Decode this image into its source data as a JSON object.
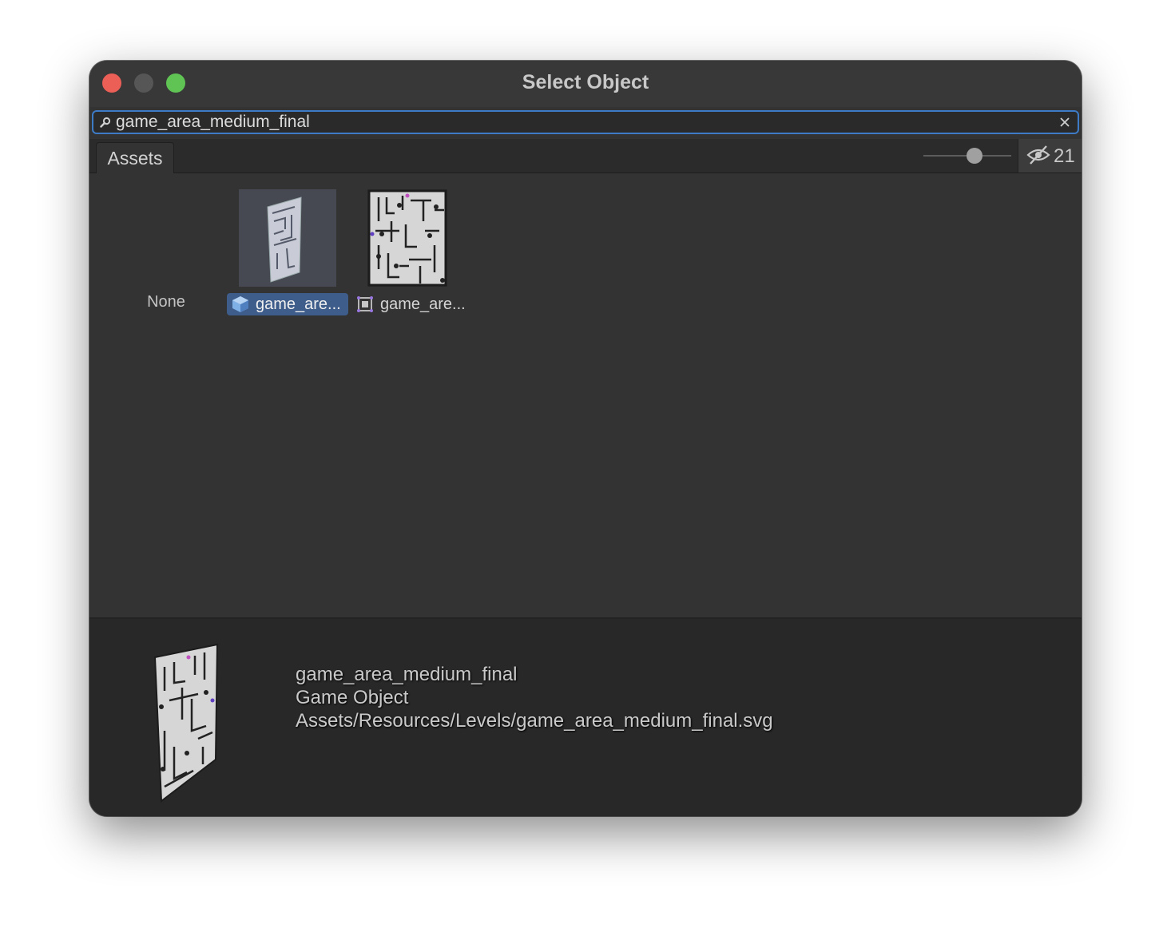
{
  "window": {
    "title": "Select Object"
  },
  "search": {
    "value": "game_area_medium_final",
    "icon": "search-icon",
    "clear_icon": "close-icon"
  },
  "toolbar": {
    "tab_label": "Assets",
    "zoom_slider_level": 0.58,
    "hidden_count": "21",
    "hidden_icon": "eye-slash-icon"
  },
  "items": [
    {
      "label": "None"
    },
    {
      "label": "game_are...",
      "icon": "prefab-icon",
      "selected": true
    },
    {
      "label": "game_are...",
      "icon": "sprite-icon",
      "selected": false
    }
  ],
  "preview": {
    "name": "game_area_medium_final",
    "type": "Game Object",
    "path": "Assets/Resources/Levels/game_area_medium_final.svg"
  },
  "colors": {
    "accent": "#3d7bc7",
    "selection": "#3f5d8b",
    "close": "#ec5f57",
    "maximize": "#5fc454"
  }
}
